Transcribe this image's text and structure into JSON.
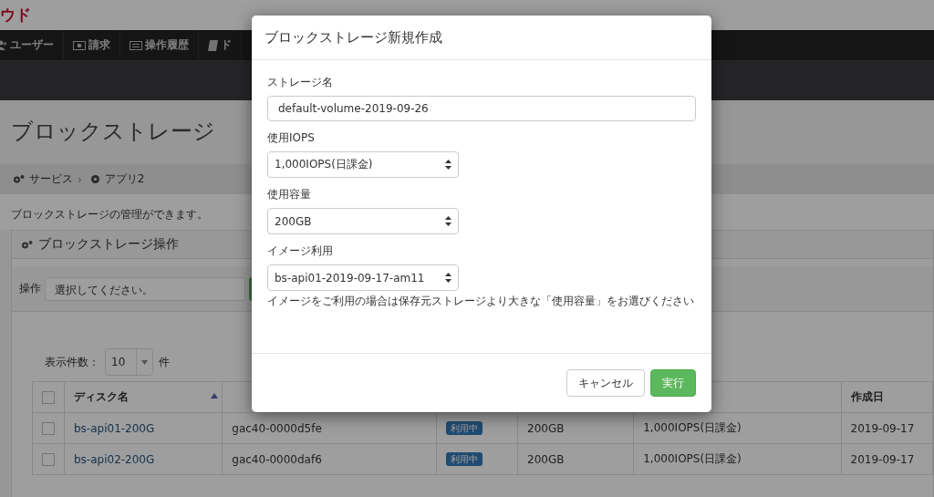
{
  "brand": {
    "text": "ウド"
  },
  "nav": [
    {
      "label": "ユーザー"
    },
    {
      "label": "請求"
    },
    {
      "label": "操作履歴"
    },
    {
      "label": "ド"
    }
  ],
  "page_title": "ブロックストレージ",
  "breadcrumb": {
    "separator": "›",
    "items": [
      {
        "label": "サービス"
      },
      {
        "label": "アプリ2"
      }
    ]
  },
  "description": "ブロックストレージの管理ができます。",
  "panel": {
    "title": "ブロックストレージ操作",
    "operation_label": "操作",
    "operation_select": "選択してください。"
  },
  "table": {
    "page_size_label": "表示件数：",
    "page_size": "10",
    "page_size_unit": "件",
    "header_checked": false,
    "columns": [
      {
        "label": "ディスク名",
        "sorted": true
      },
      {
        "label": "作成日",
        "sorted": false
      }
    ],
    "rows": [
      {
        "checked": false,
        "name": "bs-api01-200G",
        "attached": "gac40-0000d5fe",
        "status": "利用中",
        "size": "200GB",
        "iops": "1,000IOPS(日課金)",
        "created": "2019-09-17"
      },
      {
        "checked": false,
        "name": "bs-api02-200G",
        "attached": "gac40-0000daf6",
        "status": "利用中",
        "size": "200GB",
        "iops": "1,000IOPS(日課金)",
        "created": "2019-09-17"
      }
    ]
  },
  "modal": {
    "title": "ブロックストレージ新規作成",
    "fields": [
      {
        "label": "ストレージ名",
        "kind": "text",
        "value": "default-volume-2019-09-26"
      },
      {
        "label": "使用IOPS",
        "kind": "select",
        "value": "1,000IOPS(日課金)"
      },
      {
        "label": "使用容量",
        "kind": "select",
        "value": "200GB"
      },
      {
        "label": "イメージ利用",
        "kind": "select",
        "value": "bs-api01-2019-09-17-am11",
        "help": "イメージをご利用の場合は保存元ストレージより大きな「使用容量」をお選びください"
      }
    ],
    "buttons": [
      {
        "label": "キャンセル",
        "kind": "default"
      },
      {
        "label": "実行",
        "kind": "primary"
      }
    ]
  }
}
